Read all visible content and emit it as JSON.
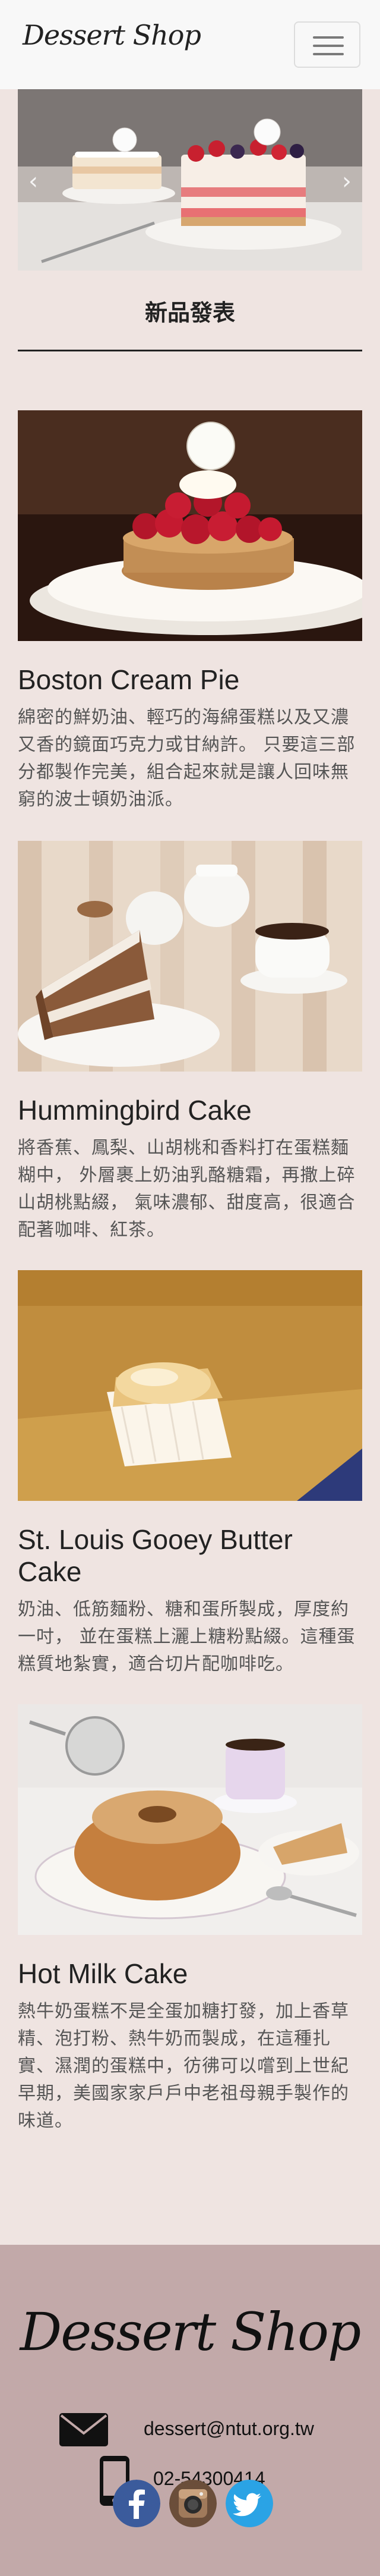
{
  "navbar": {
    "brand": "Dessert Shop",
    "toggler_icon": "hamburger-icon"
  },
  "carousel": {
    "prev_icon": "chevron-left-icon",
    "next_icon": "chevron-right-icon",
    "prev_glyph": "‹",
    "next_glyph": "›"
  },
  "section": {
    "title": "新品發表"
  },
  "products": [
    {
      "name": "Boston Cream Pie",
      "description": "綿密的鮮奶油、輕巧的海綿蛋糕以及又濃又香的鏡面巧克力或甘納許。 只要這三部分都製作完美，組合起來就是讓人回味無窮的波士頓奶油派。"
    },
    {
      "name": "Hummingbird Cake",
      "description": "將香蕉、鳳梨、山胡桃和香料打在蛋糕麵糊中， 外層裹上奶油乳酪糖霜，再撒上碎山胡桃點綴， 氣味濃郁、甜度高，很適合配著咖啡、紅茶。"
    },
    {
      "name": "St. Louis Gooey Butter Cake",
      "description": "奶油、低筋麵粉、糖和蛋所製成，厚度約一吋， 並在蛋糕上灑上糖粉點綴。這種蛋糕質地紮實，適合切片配咖啡吃。"
    },
    {
      "name": "Hot Milk Cake",
      "description": "熱牛奶蛋糕不是全蛋加糖打發，加上香草精、泡打粉、熱牛奶而製成，在這種扎實、濕潤的蛋糕中，彷彿可以嚐到上世紀早期，美國家家戶戶中老祖母親手製作的味道。"
    }
  ],
  "footer": {
    "brand": "Dessert Shop",
    "email": "dessert@ntut.org.tw",
    "phone": "02-54300414",
    "email_icon": "envelope-icon",
    "phone_icon": "mobile-phone-icon",
    "socials": [
      "facebook-icon",
      "instagram-icon",
      "twitter-icon"
    ]
  }
}
